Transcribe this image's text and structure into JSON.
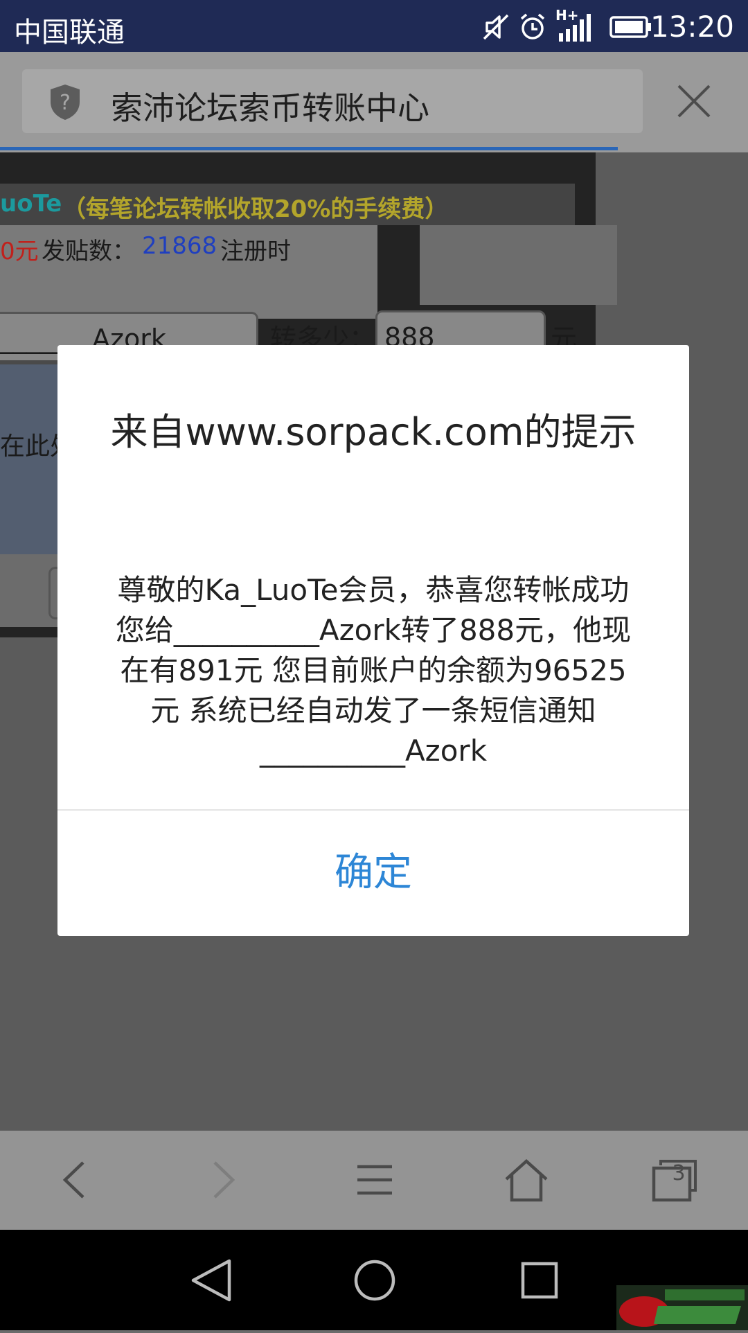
{
  "status_bar": {
    "carrier": "中国联通",
    "time": "13:20",
    "network_label": "H+",
    "icons": [
      "mute-icon",
      "alarm-icon",
      "signal-icon",
      "battery-icon"
    ]
  },
  "browser": {
    "page_title": "索沛论坛索币转账中心",
    "security_icon": "shield-question-icon",
    "close_icon": "close-icon",
    "toolbar": {
      "tabs_count": "3",
      "icons": [
        "back-icon",
        "forward-icon",
        "menu-icon",
        "home-icon",
        "tabs-icon"
      ]
    }
  },
  "page": {
    "username_fragment": "uoTe",
    "fee_notice": "（每笔论坛转帐收取20%的手续费）",
    "balance_fragment": "0元",
    "posts_label": "发贴数：",
    "posts_count": "21868",
    "register_label": "注册时",
    "recipient_value": "_______Azork",
    "amount_label": "转多少：",
    "amount_value": "888",
    "unit_label": "元",
    "message_hint_fragment": "在此处"
  },
  "dialog": {
    "title": "来自www.sorpack.com的提示",
    "message": "尊敬的Ka_LuoTe会员，恭喜您转帐成功  您给__________Azork转了888元，他现在有891元  您目前账户的余额为96525元  系统已经自动发了一条短信通知__________Azork",
    "ok_label": "确定"
  },
  "nav_bar": {
    "icons": [
      "nav-back-icon",
      "nav-home-icon",
      "nav-recents-icon"
    ]
  },
  "colors": {
    "status_bar": "#1f2a55",
    "dialog_button": "#2d86d6",
    "username_teal": "#1c9a9e",
    "fee_gold": "#b3a52b",
    "posts_blue": "#1f3fbf",
    "balance_red": "#c0211c"
  }
}
